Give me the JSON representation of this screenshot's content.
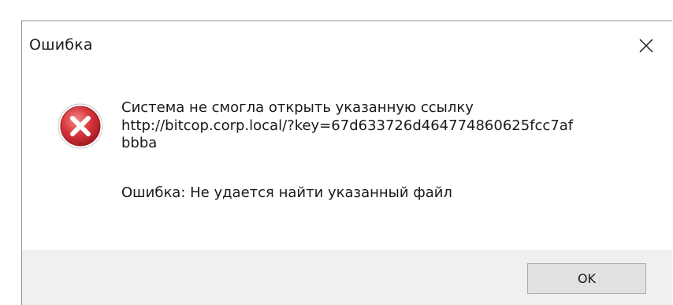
{
  "window": {
    "title": "Ошибка",
    "close_icon": "close-icon"
  },
  "message": {
    "icon": "error-icon",
    "main_text": "Система не смогла открыть указанную ссылку\nhttp://bitcop.corp.local/?key=67d633726d464774860625fcc7af\nbbba",
    "error_text": "Ошибка: Не удается найти указанный файл"
  },
  "buttons": {
    "ok_label": "OK"
  },
  "colors": {
    "error_red": "#d9363c",
    "footer_bg": "#f0f0f0",
    "button_bg": "#e1e1e1"
  }
}
